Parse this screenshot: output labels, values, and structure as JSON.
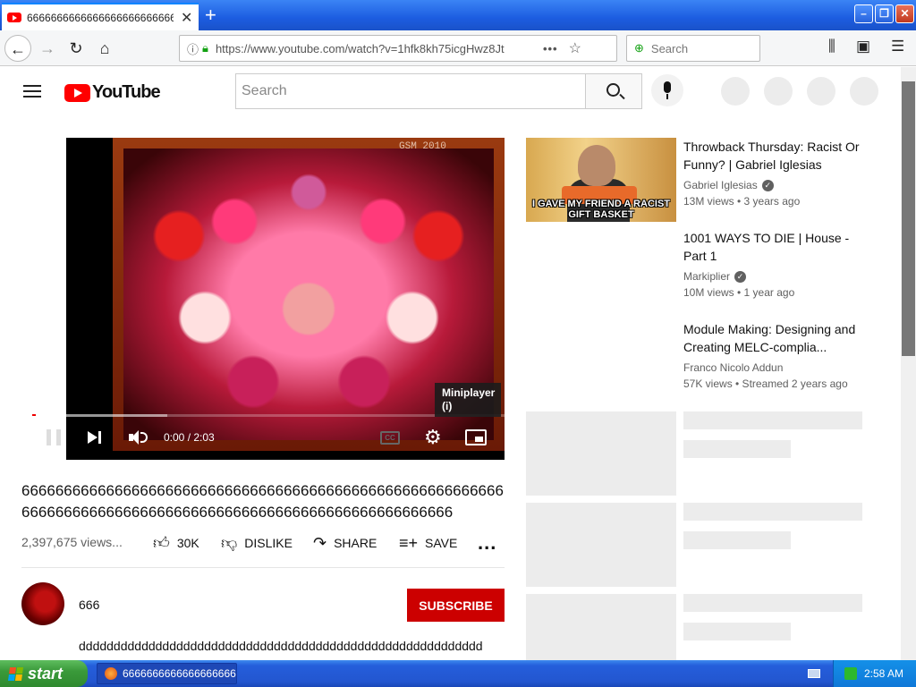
{
  "browser": {
    "tab_title": "666666666666666666666666666666666",
    "url": "https://www.youtube.com/watch?v=1hfk8kh75icgHwz8Jt",
    "search_placeholder": "Search",
    "page_actions": "•••"
  },
  "youtube": {
    "logo_text": "YouTube",
    "search_placeholder": "Search"
  },
  "player": {
    "watermark": "GSM 2010",
    "time": "0:00 / 2:03",
    "progress_fraction": 0,
    "buffered_fraction": 0.23,
    "cc_label": "CC",
    "tooltip_title": "Miniplayer",
    "tooltip_key": "(i)"
  },
  "video": {
    "title": "666666666666666666666666666666666666666666666666666666666666666666666666666666666666666666666666666666666666",
    "views": "2,397,675 views...",
    "like_count": "30K",
    "dislike_label": "DISLIKE",
    "share_label": "SHARE",
    "save_label": "SAVE",
    "more_label": "..."
  },
  "channel": {
    "name": "666",
    "subscribe_label": "SUBSCRIBE"
  },
  "description": "dddddddddddddddddddddddddddddddddddddddddddddddddddddddddd",
  "recommendations": [
    {
      "title": "Throwback Thursday: Racist Or Funny? | Gabriel Iglesias",
      "channel": "Gabriel Iglesias",
      "meta": "13M views • 3 years ago",
      "thumb_caption": "I GAVE MY FRIEND A RACIST GIFT BASKET"
    },
    {
      "title": "1001 WAYS TO DIE | House - Part 1",
      "channel": "Markiplier",
      "meta": "10M views • 1 year ago"
    },
    {
      "title": "Module Making: Designing and Creating MELC-complia...",
      "channel": "Franco Nicolo Addun",
      "meta": "57K views • Streamed 2 years ago"
    }
  ],
  "taskbar": {
    "start_label": "start",
    "task_title": "66666666666666666666...",
    "clock": "2:58 AM"
  },
  "colors": {
    "youtube_red": "#ff0000",
    "subscribe_red": "#cc0000",
    "xp_blue": "#245edb",
    "xp_green": "#3a9a3a"
  }
}
